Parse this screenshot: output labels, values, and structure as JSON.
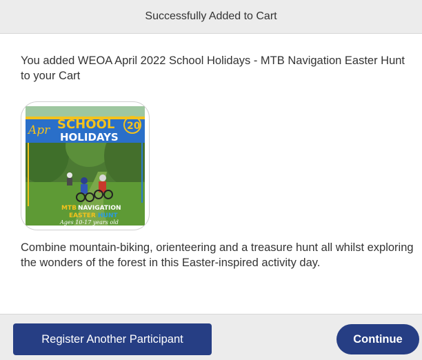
{
  "modal": {
    "title": "Successfully Added to Cart"
  },
  "cart": {
    "added_message": "You added WEOA April 2022 School Holidays - MTB Navigation Easter Hunt to your Cart"
  },
  "product": {
    "image_text": {
      "month": "Apr",
      "school": "SCHOOL",
      "holidays": "HOLIDAYS",
      "year": "20",
      "mtb": "MTB",
      "navigation": "NAVIGATION",
      "easter": "EASTER",
      "hunt": "HUNT",
      "ages": "Ages 10-17 years old"
    },
    "description": "Combine mountain-biking, orienteering and a treasure hunt all whilst exploring the wonders of the forest in this Easter-inspired activity day."
  },
  "footer": {
    "register_label": "Register Another Participant",
    "continue_label": "Continue"
  },
  "colors": {
    "header_bg": "#ececec",
    "button_bg": "#263e84",
    "button_text": "#ffffff",
    "body_text": "#333333"
  }
}
